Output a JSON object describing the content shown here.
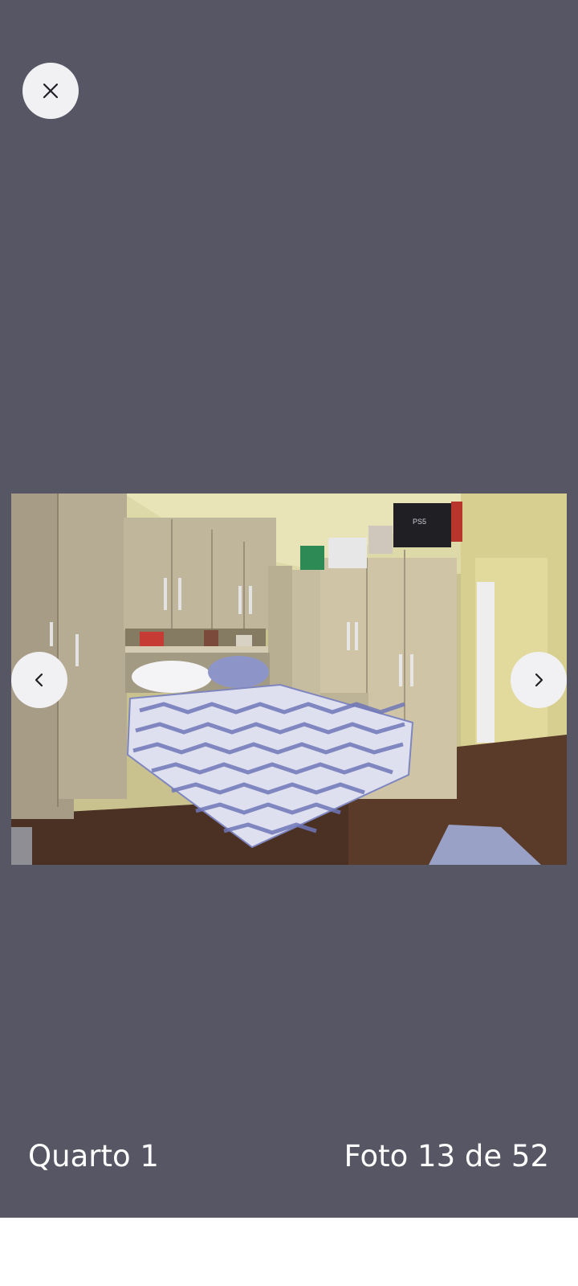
{
  "viewer": {
    "background_color": "#575664",
    "close_icon": "close-icon",
    "prev_icon": "chevron-left-icon",
    "next_icon": "chevron-right-icon"
  },
  "photo": {
    "subject": "bedroom-photo",
    "box_label": "PS5"
  },
  "caption": {
    "room_name": "Quarto 1",
    "counter": "Foto 13 de 52"
  }
}
